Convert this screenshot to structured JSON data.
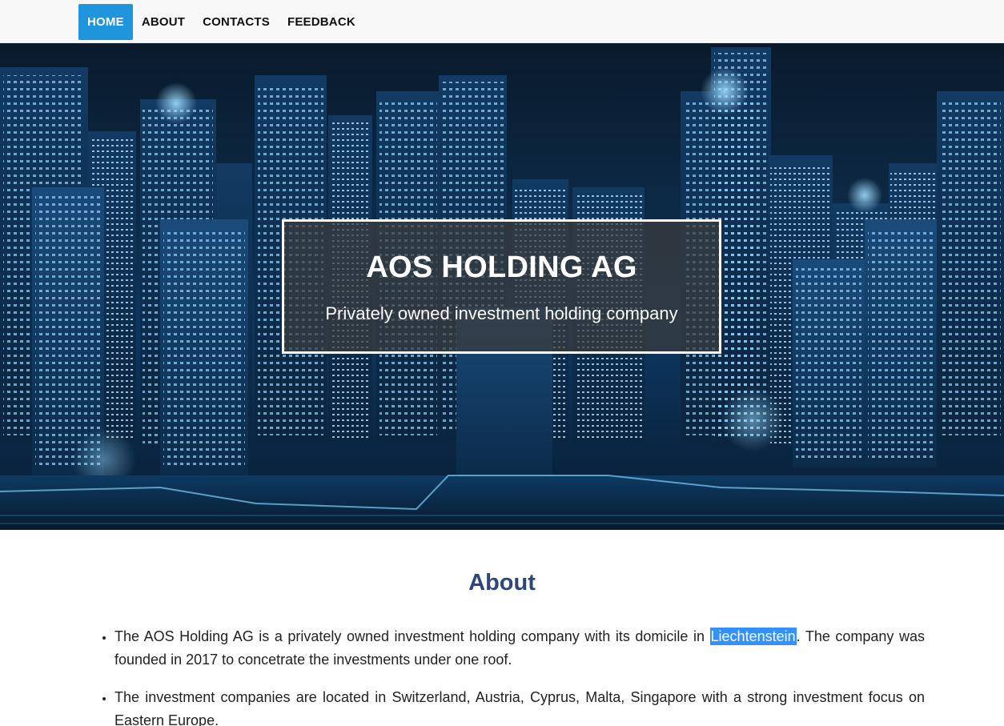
{
  "nav": {
    "items": [
      {
        "label": "HOME",
        "active": true
      },
      {
        "label": "ABOUT",
        "active": false
      },
      {
        "label": "CONTACTS",
        "active": false
      },
      {
        "label": "FEEDBACK",
        "active": false
      }
    ],
    "active_color": "#1e95dc"
  },
  "hero": {
    "title": "AOS HOLDING AG",
    "subtitle": "Privately owned investment holding company"
  },
  "about": {
    "heading": "About",
    "items": [
      {
        "before": "The AOS Holding AG is a privately owned investment holding company with its domicile in ",
        "highlight": "Liechtenstein",
        "after": ". The company was founded in 2017 to concetrate the investments under one roof."
      },
      {
        "text": "The investment companies are located in Switzerland, Austria, Cyprus, Malta, Singapore with a strong investment focus on Eastern Europe."
      }
    ],
    "heading_color": "#2f4679",
    "selection_color": "#3390ff"
  }
}
